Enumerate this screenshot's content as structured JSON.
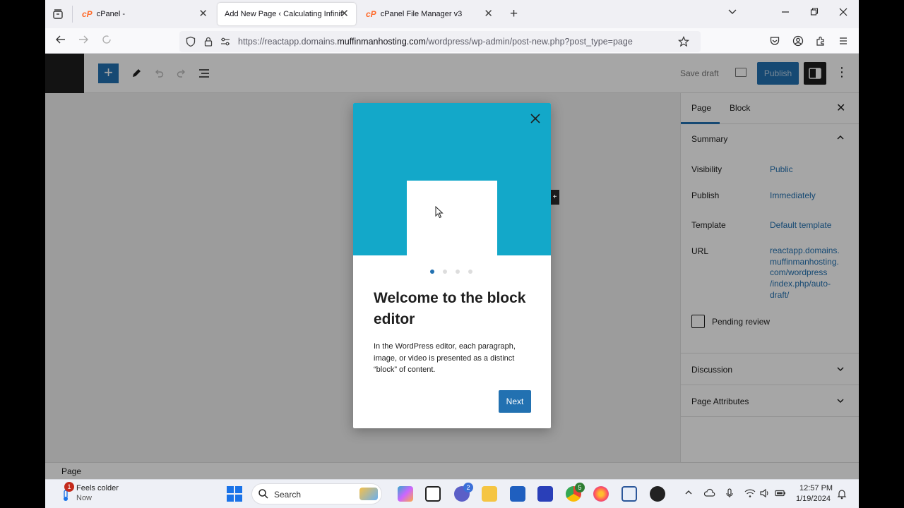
{
  "browser": {
    "tabs": [
      {
        "title": "cPanel -",
        "active": false
      },
      {
        "title": "Add New Page ‹ Calculating Infinity",
        "active": true
      },
      {
        "title": "cPanel File Manager v3",
        "active": false
      }
    ],
    "url_prefix": "https://reactapp.domains.",
    "url_host": "muffinmanhosting.com",
    "url_suffix": "/wordpress/wp-admin/post-new.php?post_type=page"
  },
  "editor": {
    "save_draft": "Save draft",
    "publish": "Publish",
    "footer_label": "Page"
  },
  "sidebar": {
    "tab_page": "Page",
    "tab_block": "Block",
    "summary_title": "Summary",
    "rows": [
      {
        "label": "Visibility",
        "value": "Public"
      },
      {
        "label": "Publish",
        "value": "Immediately"
      },
      {
        "label": "Template",
        "value": "Default template"
      },
      {
        "label": "URL",
        "value": "reactapp.domains.\nmuffinmanhosting.\ncom/wordpress\n/index.php/auto-\ndraft/"
      }
    ],
    "pending_review": "Pending review",
    "discussion": "Discussion",
    "page_attributes": "Page Attributes"
  },
  "modal": {
    "title": "Welcome to the block editor",
    "body": "In the WordPress editor, each paragraph, image, or video is presented as a distinct “block” of content.",
    "next": "Next",
    "page_count": 4,
    "current_page": 1
  },
  "taskbar": {
    "weather_line1": "Feels colder",
    "weather_line2": "Now",
    "weather_badge": "1",
    "search_placeholder": "Search",
    "time": "12:57 PM",
    "date": "1/19/2024",
    "chat_badge": "2",
    "chrome_badge": "5"
  },
  "colors": {
    "wp_accent": "#2271b1",
    "modal_hero": "#13a8c9",
    "cpanel_orange": "#ff6c2c"
  }
}
